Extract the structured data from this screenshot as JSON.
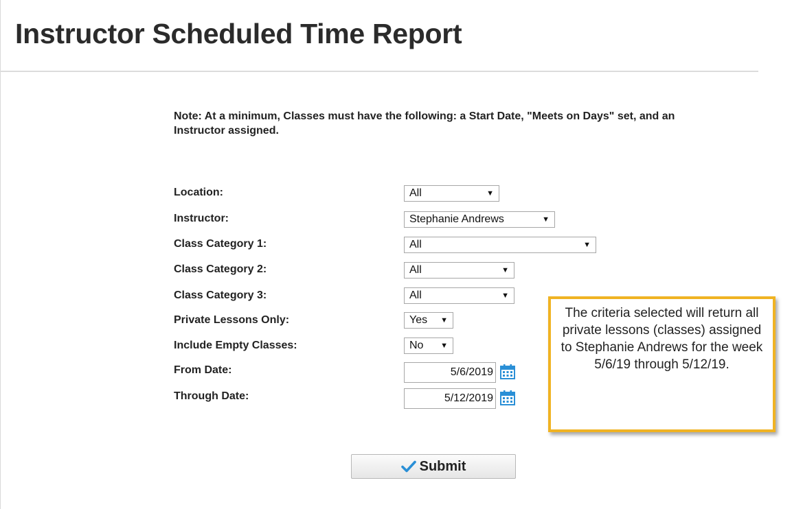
{
  "page": {
    "title": "Instructor Scheduled Time Report",
    "note": "Note:  At a minimum, Classes must have the following: a Start Date, \"Meets on Days\" set, and an Instructor assigned."
  },
  "form": {
    "location": {
      "label": "Location:",
      "value": "All"
    },
    "instructor": {
      "label": "Instructor:",
      "value": "Stephanie Andrews"
    },
    "class_category_1": {
      "label": "Class Category 1:",
      "value": "All"
    },
    "class_category_2": {
      "label": "Class Category 2:",
      "value": "All"
    },
    "class_category_3": {
      "label": "Class Category 3:",
      "value": "All"
    },
    "private_lessons_only": {
      "label": "Private Lessons Only:",
      "value": "Yes"
    },
    "include_empty_classes": {
      "label": "Include Empty Classes:",
      "value": "No"
    },
    "from_date": {
      "label": "From Date:",
      "value": "5/6/2019"
    },
    "through_date": {
      "label": "Through Date:",
      "value": "5/12/2019"
    },
    "dropdown_caret": "▼",
    "calendar_icon": "calendar-icon"
  },
  "callout": {
    "text": "The criteria selected will return all private lessons (classes) assigned to Stephanie Andrews for the week 5/6/19 through 5/12/19."
  },
  "submit": {
    "label": "Submit",
    "icon": "checkmark-icon"
  },
  "colors": {
    "callout_border": "#f0b323",
    "calendar_icon": "#2a8fd6",
    "checkmark": "#2a8fd6"
  }
}
